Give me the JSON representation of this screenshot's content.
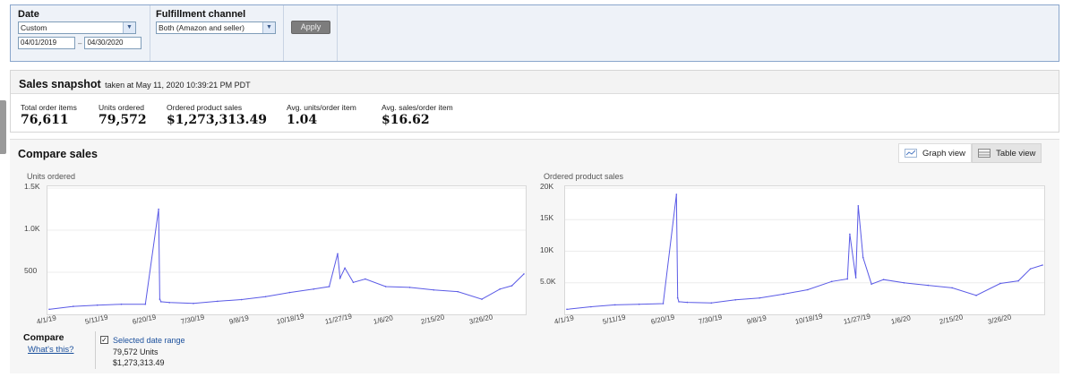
{
  "filters": {
    "date_label": "Date",
    "date_select": "Custom",
    "start_date": "04/01/2019",
    "date_separator": "–",
    "end_date": "04/30/2020",
    "channel_label": "Fulfillment channel",
    "channel_select": "Both (Amazon and seller)",
    "apply_label": "Apply"
  },
  "snapshot": {
    "title": "Sales snapshot",
    "taken_at": "taken at May 11, 2020 10:39:21 PM PDT",
    "metrics": [
      {
        "label": "Total order items",
        "value": "76,611"
      },
      {
        "label": "Units ordered",
        "value": "79,572"
      },
      {
        "label": "Ordered product sales",
        "value": "$1,273,313.49"
      },
      {
        "label": "Avg. units/order item",
        "value": "1.04"
      },
      {
        "label": "Avg. sales/order item",
        "value": "$16.62"
      }
    ]
  },
  "compare_sales": {
    "title": "Compare sales",
    "graph_view": "Graph view",
    "table_view": "Table view",
    "compare_label": "Compare",
    "whats_this": "What's this?",
    "range_label": "Selected date range",
    "range_units": "79,572 Units",
    "range_sales": "$1,273,313.49",
    "checkbox_mark": "✓"
  },
  "colors": {
    "line": "#5a5ae6",
    "accent_link": "#1a4f9c"
  },
  "chart_data": [
    {
      "type": "line",
      "ylabel": "Units ordered",
      "yticks": [
        "1.5K",
        "1.0K",
        "500"
      ],
      "ylim": [
        0,
        1500
      ],
      "xticks": [
        "4/1/19",
        "5/11/19",
        "6/20/19",
        "7/30/19",
        "9/8/19",
        "10/18/19",
        "11/27/19",
        "1/6/20",
        "2/15/20",
        "3/26/20"
      ],
      "x": [
        "4/1/19",
        "4/21/19",
        "5/11/19",
        "5/31/19",
        "6/20/19",
        "7/1/19",
        "7/2/19",
        "7/3/19",
        "7/10/19",
        "7/30/19",
        "8/19/19",
        "9/8/19",
        "9/28/19",
        "10/18/19",
        "11/7/19",
        "11/20/19",
        "11/27/19",
        "11/29/19",
        "12/3/19",
        "12/10/19",
        "12/20/19",
        "1/6/20",
        "1/26/20",
        "2/15/20",
        "3/6/20",
        "3/26/20",
        "4/10/20",
        "4/20/20",
        "4/30/20"
      ],
      "series": [
        {
          "values": [
            60,
            95,
            110,
            120,
            120,
            1250,
            180,
            150,
            140,
            130,
            155,
            175,
            210,
            260,
            300,
            330,
            720,
            430,
            550,
            380,
            420,
            330,
            320,
            290,
            270,
            180,
            300,
            340,
            480
          ]
        }
      ]
    },
    {
      "type": "line",
      "ylabel": "Ordered product sales",
      "yticks": [
        "20K",
        "15K",
        "10K",
        "5.0K"
      ],
      "ylim": [
        0,
        20000
      ],
      "xticks": [
        "4/1/19",
        "5/11/19",
        "6/20/19",
        "7/30/19",
        "9/8/19",
        "10/18/19",
        "11/27/19",
        "1/6/20",
        "2/15/20",
        "3/26/20"
      ],
      "x": [
        "4/1/19",
        "4/21/19",
        "5/11/19",
        "5/31/19",
        "6/20/19",
        "7/1/19",
        "7/2/19",
        "7/3/19",
        "7/10/19",
        "7/30/19",
        "8/19/19",
        "9/8/19",
        "9/28/19",
        "10/18/19",
        "11/7/19",
        "11/20/19",
        "11/22/19",
        "11/27/19",
        "11/29/19",
        "12/3/19",
        "12/10/19",
        "12/20/19",
        "1/6/20",
        "1/26/20",
        "2/15/20",
        "3/6/20",
        "3/26/20",
        "4/10/20",
        "4/20/20",
        "4/30/20"
      ],
      "series": [
        {
          "values": [
            800,
            1200,
            1500,
            1600,
            1700,
            19000,
            2600,
            2000,
            1900,
            1800,
            2300,
            2600,
            3200,
            3900,
            5200,
            5600,
            12700,
            5800,
            17200,
            9000,
            4800,
            5500,
            5000,
            4600,
            4200,
            3000,
            4900,
            5300,
            7200,
            7800
          ]
        }
      ]
    }
  ]
}
